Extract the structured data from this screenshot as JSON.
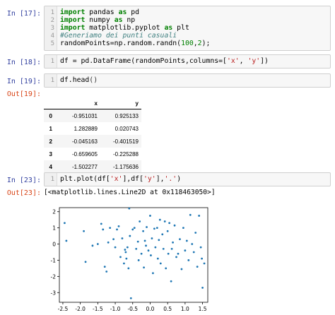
{
  "cells": {
    "c17": {
      "prompt": "In [17]:",
      "line_numbers": [
        "1",
        "2",
        "3",
        "4",
        "5"
      ],
      "tokens": {
        "l1_kw1": "import",
        "l1_a": " pandas ",
        "l1_kw2": "as",
        "l1_b": " pd",
        "l2_kw1": "import",
        "l2_a": " numpy ",
        "l2_kw2": "as",
        "l2_b": " np",
        "l3_kw1": "import",
        "l3_a": " matplotlib.pyplot ",
        "l3_kw2": "as",
        "l3_b": " plt",
        "l4_comment": "#Generiamo dei punti casuali",
        "l5_a": "randomPoints=np.random.randn(",
        "l5_n1": "100",
        "l5_c": ",",
        "l5_n2": "2",
        "l5_d": ");"
      }
    },
    "c18": {
      "prompt": "In [18]:",
      "line_number": "1",
      "tokens": {
        "a": "df = pd.DataFrame(randomPoints,columns=[",
        "s1": "'x'",
        "b": ", ",
        "s2": "'y'",
        "c": "])"
      }
    },
    "c19": {
      "prompt": "In [19]:",
      "line_number": "1",
      "tokens": {
        "a": "df.head",
        "b": "()"
      }
    },
    "out19": {
      "prompt": "Out[19]:",
      "columns": [
        "x",
        "y"
      ],
      "rows": [
        {
          "index": "0",
          "x": "-0.951031",
          "y": "0.925133"
        },
        {
          "index": "1",
          "x": "1.282889",
          "y": "0.020743"
        },
        {
          "index": "2",
          "x": "-0.045163",
          "y": "-0.401519"
        },
        {
          "index": "3",
          "x": "-0.659605",
          "y": "-0.225288"
        },
        {
          "index": "4",
          "x": "-1.502277",
          "y": "-1.175636"
        }
      ]
    },
    "c23": {
      "prompt": "In [23]:",
      "line_number": "1",
      "tokens": {
        "a": "plt.plot(df[",
        "s1": "'x'",
        "b": "],df[",
        "s2": "'y'",
        "c": "],",
        "s3": "'.'",
        "d": ")"
      }
    },
    "out23": {
      "prompt": "Out[23]:",
      "text": "[<matplotlib.lines.Line2D at 0x118463050>]"
    }
  },
  "chart_data": {
    "type": "scatter",
    "marker_color": "#1f77b4",
    "xlim": [
      -2.6,
      1.65
    ],
    "ylim": [
      -3.6,
      2.25
    ],
    "xticks": [
      "-2.5",
      "-2.0",
      "-1.5",
      "-1.0",
      "-0.5",
      "0.0",
      "0.5",
      "1.0",
      "1.5"
    ],
    "yticks": [
      "2",
      "1",
      "0",
      "-1",
      "-2",
      "-3"
    ],
    "points": [
      [
        -2.45,
        1.3
      ],
      [
        -2.4,
        0.2
      ],
      [
        -1.9,
        0.8
      ],
      [
        -1.85,
        -1.1
      ],
      [
        -1.65,
        -0.1
      ],
      [
        -1.5,
        0.0
      ],
      [
        -1.4,
        1.25
      ],
      [
        -1.35,
        0.9
      ],
      [
        -1.3,
        -1.4
      ],
      [
        -1.25,
        -1.7
      ],
      [
        -1.2,
        0.1
      ],
      [
        -1.15,
        1.0
      ],
      [
        -1.05,
        0.3
      ],
      [
        -1.0,
        -0.2
      ],
      [
        -0.95,
        0.9
      ],
      [
        -0.9,
        1.1
      ],
      [
        -0.85,
        -0.8
      ],
      [
        -0.8,
        0.35
      ],
      [
        -0.75,
        -1.2
      ],
      [
        -0.72,
        -0.35
      ],
      [
        -0.7,
        -0.5
      ],
      [
        -0.68,
        -0.9
      ],
      [
        -0.65,
        -0.2
      ],
      [
        -0.62,
        -1.5
      ],
      [
        -0.6,
        2.2
      ],
      [
        -0.58,
        0.5
      ],
      [
        -0.55,
        -3.35
      ],
      [
        -0.5,
        0.9
      ],
      [
        -0.45,
        1.0
      ],
      [
        -0.4,
        -0.3
      ],
      [
        -0.35,
        0.15
      ],
      [
        -0.33,
        -1.0
      ],
      [
        -0.3,
        1.4
      ],
      [
        -0.25,
        -0.6
      ],
      [
        -0.2,
        0.8
      ],
      [
        -0.18,
        -1.45
      ],
      [
        -0.15,
        0.2
      ],
      [
        -0.12,
        -0.1
      ],
      [
        -0.1,
        1.05
      ],
      [
        -0.05,
        -0.4
      ],
      [
        0.0,
        1.75
      ],
      [
        0.02,
        -0.7
      ],
      [
        0.05,
        0.35
      ],
      [
        0.08,
        -1.8
      ],
      [
        0.12,
        0.95
      ],
      [
        0.15,
        -0.2
      ],
      [
        0.2,
        1.0
      ],
      [
        0.22,
        -0.9
      ],
      [
        0.25,
        0.25
      ],
      [
        0.28,
        1.5
      ],
      [
        0.3,
        -1.2
      ],
      [
        0.35,
        0.6
      ],
      [
        0.38,
        -0.3
      ],
      [
        0.42,
        1.4
      ],
      [
        0.45,
        -1.5
      ],
      [
        0.5,
        0.8
      ],
      [
        0.52,
        -0.6
      ],
      [
        0.55,
        1.3
      ],
      [
        0.6,
        -2.3
      ],
      [
        0.62,
        -0.3
      ],
      [
        0.65,
        0.1
      ],
      [
        0.7,
        1.15
      ],
      [
        0.75,
        -0.8
      ],
      [
        0.8,
        -0.6
      ],
      [
        0.85,
        0.3
      ],
      [
        0.9,
        -1.55
      ],
      [
        0.95,
        1.0
      ],
      [
        1.0,
        -0.4
      ],
      [
        1.05,
        0.2
      ],
      [
        1.1,
        -1.0
      ],
      [
        1.15,
        1.8
      ],
      [
        1.2,
        0.0
      ],
      [
        1.25,
        -0.5
      ],
      [
        1.3,
        0.7
      ],
      [
        1.35,
        -1.4
      ],
      [
        1.4,
        1.75
      ],
      [
        1.45,
        -0.2
      ],
      [
        1.48,
        -0.9
      ],
      [
        1.5,
        -2.7
      ],
      [
        1.55,
        -1.2
      ]
    ]
  }
}
